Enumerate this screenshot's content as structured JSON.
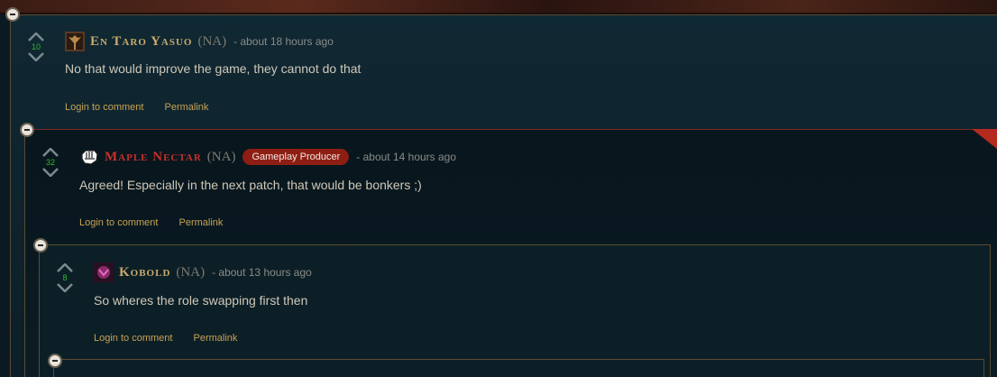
{
  "comments": [
    {
      "username": "En Taro Yasuo",
      "region": "(NA)",
      "timestamp": "- about 18 hours ago",
      "votes": "10",
      "text": "No that would improve the game, they cannot do that",
      "login_label": "Login to comment",
      "permalink_label": "Permalink"
    },
    {
      "username": "Maple Nectar",
      "region": "(NA)",
      "badge": "Gameplay Producer",
      "timestamp": "- about 14 hours ago",
      "votes": "32",
      "text": "Agreed! Especially in the next patch, that would be bonkers ;)",
      "login_label": "Login to comment",
      "permalink_label": "Permalink"
    },
    {
      "username": "Kobold",
      "region": "(NA)",
      "timestamp": "- about 13 hours ago",
      "votes": "8",
      "text": "So wheres the role swapping first then",
      "login_label": "Login to comment",
      "permalink_label": "Permalink"
    }
  ],
  "colors": {
    "accent_gold": "#c8a253",
    "riot_red": "#c5302a",
    "badge_bg": "#8e1e13",
    "vote_green": "#2db82d"
  }
}
